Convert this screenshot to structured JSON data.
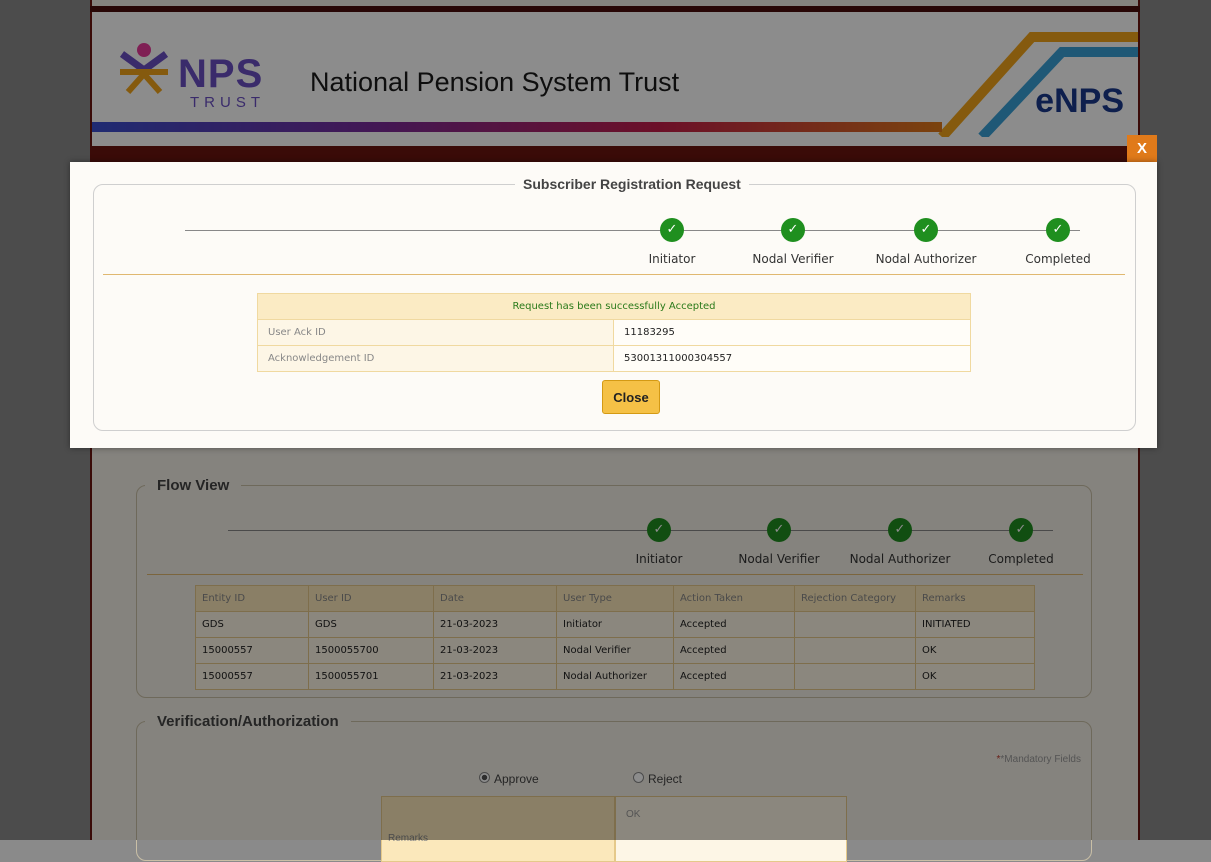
{
  "header": {
    "logo_nps": "NPS",
    "logo_trust": "TRUST",
    "org_title": "National Pension System Trust",
    "enps": "eNPS"
  },
  "flow_view": {
    "legend": "Flow View",
    "steps": [
      "Initiator",
      "Nodal Verifier",
      "Nodal Authorizer",
      "Completed"
    ],
    "table": {
      "headers": [
        "Entity ID",
        "User ID",
        "Date",
        "User Type",
        "Action Taken",
        "Rejection Category",
        "Remarks"
      ],
      "rows": [
        [
          "GDS",
          "GDS",
          "21-03-2023",
          "Initiator",
          "Accepted",
          "",
          "INITIATED"
        ],
        [
          "15000557",
          "1500055700",
          "21-03-2023",
          "Nodal Verifier",
          "Accepted",
          "",
          "OK"
        ],
        [
          "15000557",
          "1500055701",
          "21-03-2023",
          "Nodal Authorizer",
          "Accepted",
          "",
          "OK"
        ]
      ]
    }
  },
  "verification": {
    "legend": "Verification/Authorization",
    "mandatory_note": "*Mandatory Fields",
    "approve_label": "Approve",
    "reject_label": "Reject",
    "approve_selected": true,
    "remarks_label": "Remarks",
    "remarks_value": "OK"
  },
  "modal": {
    "close_x": "X",
    "legend": "Subscriber Registration Request",
    "steps": [
      "Initiator",
      "Nodal Verifier",
      "Nodal Authorizer",
      "Completed"
    ],
    "message": "Request has been successfully Accepted",
    "rows": [
      {
        "label": "User Ack ID",
        "value": "11183295"
      },
      {
        "label": "Acknowledgement ID",
        "value": "53001311000304557"
      }
    ],
    "close_button": "Close"
  },
  "colors": {
    "accent": "#f5c146",
    "success": "#1f8f1f",
    "brand_purple": "#6b4fc4",
    "enps_blue": "#1a3a8c"
  }
}
